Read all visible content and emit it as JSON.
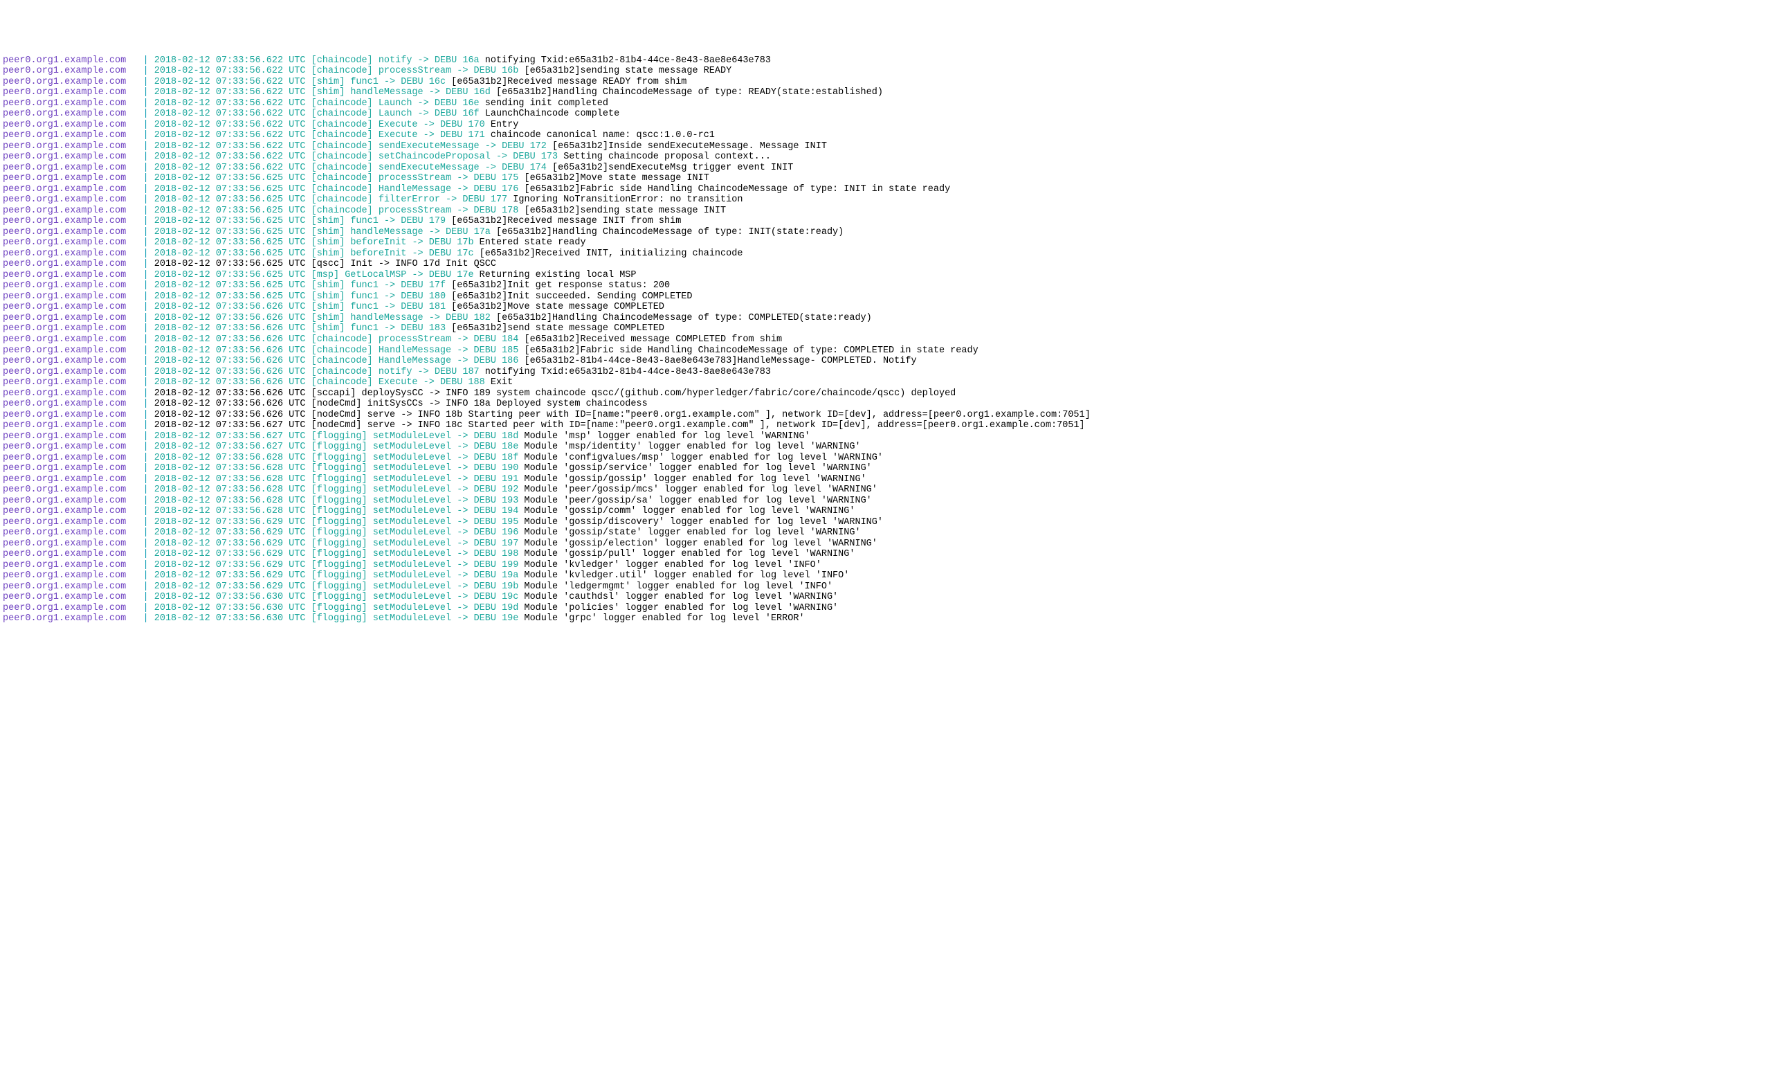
{
  "host": "peer0.org1.example.com",
  "separator": "|",
  "lines": [
    {
      "ts": "2018-02-12 07:33:56.622 UTC",
      "mod": "[chaincode]",
      "fn": "notify",
      "lvl": "DEBU",
      "num": "16a",
      "msg": "notifying Txid:e65a31b2-81b4-44ce-8e43-8ae8e643e783",
      "info": false
    },
    {
      "ts": "2018-02-12 07:33:56.622 UTC",
      "mod": "[chaincode]",
      "fn": "processStream",
      "lvl": "DEBU",
      "num": "16b",
      "msg": "[e65a31b2]sending state message READY",
      "info": false
    },
    {
      "ts": "2018-02-12 07:33:56.622 UTC",
      "mod": "[shim]",
      "fn": "func1",
      "lvl": "DEBU",
      "num": "16c",
      "msg": "[e65a31b2]Received message READY from shim",
      "info": false
    },
    {
      "ts": "2018-02-12 07:33:56.622 UTC",
      "mod": "[shim]",
      "fn": "handleMessage",
      "lvl": "DEBU",
      "num": "16d",
      "msg": "[e65a31b2]Handling ChaincodeMessage of type: READY(state:established)",
      "info": false
    },
    {
      "ts": "2018-02-12 07:33:56.622 UTC",
      "mod": "[chaincode]",
      "fn": "Launch",
      "lvl": "DEBU",
      "num": "16e",
      "msg": "sending init completed",
      "info": false
    },
    {
      "ts": "2018-02-12 07:33:56.622 UTC",
      "mod": "[chaincode]",
      "fn": "Launch",
      "lvl": "DEBU",
      "num": "16f",
      "msg": "LaunchChaincode complete",
      "info": false
    },
    {
      "ts": "2018-02-12 07:33:56.622 UTC",
      "mod": "[chaincode]",
      "fn": "Execute",
      "lvl": "DEBU",
      "num": "170",
      "msg": "Entry",
      "info": false
    },
    {
      "ts": "2018-02-12 07:33:56.622 UTC",
      "mod": "[chaincode]",
      "fn": "Execute",
      "lvl": "DEBU",
      "num": "171",
      "msg": "chaincode canonical name: qscc:1.0.0-rc1",
      "info": false
    },
    {
      "ts": "2018-02-12 07:33:56.622 UTC",
      "mod": "[chaincode]",
      "fn": "sendExecuteMessage",
      "lvl": "DEBU",
      "num": "172",
      "msg": "[e65a31b2]Inside sendExecuteMessage. Message INIT",
      "info": false
    },
    {
      "ts": "2018-02-12 07:33:56.622 UTC",
      "mod": "[chaincode]",
      "fn": "setChaincodeProposal",
      "lvl": "DEBU",
      "num": "173",
      "msg": "Setting chaincode proposal context...",
      "info": false
    },
    {
      "ts": "2018-02-12 07:33:56.622 UTC",
      "mod": "[chaincode]",
      "fn": "sendExecuteMessage",
      "lvl": "DEBU",
      "num": "174",
      "msg": "[e65a31b2]sendExecuteMsg trigger event INIT",
      "info": false
    },
    {
      "ts": "2018-02-12 07:33:56.625 UTC",
      "mod": "[chaincode]",
      "fn": "processStream",
      "lvl": "DEBU",
      "num": "175",
      "msg": "[e65a31b2]Move state message INIT",
      "info": false
    },
    {
      "ts": "2018-02-12 07:33:56.625 UTC",
      "mod": "[chaincode]",
      "fn": "HandleMessage",
      "lvl": "DEBU",
      "num": "176",
      "msg": "[e65a31b2]Fabric side Handling ChaincodeMessage of type: INIT in state ready",
      "info": false
    },
    {
      "ts": "2018-02-12 07:33:56.625 UTC",
      "mod": "[chaincode]",
      "fn": "filterError",
      "lvl": "DEBU",
      "num": "177",
      "msg": "Ignoring NoTransitionError: no transition",
      "info": false
    },
    {
      "ts": "2018-02-12 07:33:56.625 UTC",
      "mod": "[chaincode]",
      "fn": "processStream",
      "lvl": "DEBU",
      "num": "178",
      "msg": "[e65a31b2]sending state message INIT",
      "info": false
    },
    {
      "ts": "2018-02-12 07:33:56.625 UTC",
      "mod": "[shim]",
      "fn": "func1",
      "lvl": "DEBU",
      "num": "179",
      "msg": "[e65a31b2]Received message INIT from shim",
      "info": false
    },
    {
      "ts": "2018-02-12 07:33:56.625 UTC",
      "mod": "[shim]",
      "fn": "handleMessage",
      "lvl": "DEBU",
      "num": "17a",
      "msg": "[e65a31b2]Handling ChaincodeMessage of type: INIT(state:ready)",
      "info": false
    },
    {
      "ts": "2018-02-12 07:33:56.625 UTC",
      "mod": "[shim]",
      "fn": "beforeInit",
      "lvl": "DEBU",
      "num": "17b",
      "msg": "Entered state ready",
      "info": false
    },
    {
      "ts": "2018-02-12 07:33:56.625 UTC",
      "mod": "[shim]",
      "fn": "beforeInit",
      "lvl": "DEBU",
      "num": "17c",
      "msg": "[e65a31b2]Received INIT, initializing chaincode",
      "info": false
    },
    {
      "ts": "2018-02-12 07:33:56.625 UTC",
      "mod": "[qscc]",
      "fn": "Init",
      "lvl": "INFO",
      "num": "17d",
      "msg": "Init QSCC",
      "info": true
    },
    {
      "ts": "2018-02-12 07:33:56.625 UTC",
      "mod": "[msp]",
      "fn": "GetLocalMSP",
      "lvl": "DEBU",
      "num": "17e",
      "msg": "Returning existing local MSP",
      "info": false
    },
    {
      "ts": "2018-02-12 07:33:56.625 UTC",
      "mod": "[shim]",
      "fn": "func1",
      "lvl": "DEBU",
      "num": "17f",
      "msg": "[e65a31b2]Init get response status: 200",
      "info": false
    },
    {
      "ts": "2018-02-12 07:33:56.625 UTC",
      "mod": "[shim]",
      "fn": "func1",
      "lvl": "DEBU",
      "num": "180",
      "msg": "[e65a31b2]Init succeeded. Sending COMPLETED",
      "info": false
    },
    {
      "ts": "2018-02-12 07:33:56.626 UTC",
      "mod": "[shim]",
      "fn": "func1",
      "lvl": "DEBU",
      "num": "181",
      "msg": "[e65a31b2]Move state message COMPLETED",
      "info": false
    },
    {
      "ts": "2018-02-12 07:33:56.626 UTC",
      "mod": "[shim]",
      "fn": "handleMessage",
      "lvl": "DEBU",
      "num": "182",
      "msg": "[e65a31b2]Handling ChaincodeMessage of type: COMPLETED(state:ready)",
      "info": false
    },
    {
      "ts": "2018-02-12 07:33:56.626 UTC",
      "mod": "[shim]",
      "fn": "func1",
      "lvl": "DEBU",
      "num": "183",
      "msg": "[e65a31b2]send state message COMPLETED",
      "info": false
    },
    {
      "ts": "2018-02-12 07:33:56.626 UTC",
      "mod": "[chaincode]",
      "fn": "processStream",
      "lvl": "DEBU",
      "num": "184",
      "msg": "[e65a31b2]Received message COMPLETED from shim",
      "info": false
    },
    {
      "ts": "2018-02-12 07:33:56.626 UTC",
      "mod": "[chaincode]",
      "fn": "HandleMessage",
      "lvl": "DEBU",
      "num": "185",
      "msg": "[e65a31b2]Fabric side Handling ChaincodeMessage of type: COMPLETED in state ready",
      "info": false
    },
    {
      "ts": "2018-02-12 07:33:56.626 UTC",
      "mod": "[chaincode]",
      "fn": "HandleMessage",
      "lvl": "DEBU",
      "num": "186",
      "msg": "[e65a31b2-81b4-44ce-8e43-8ae8e643e783]HandleMessage- COMPLETED. Notify",
      "info": false
    },
    {
      "ts": "2018-02-12 07:33:56.626 UTC",
      "mod": "[chaincode]",
      "fn": "notify",
      "lvl": "DEBU",
      "num": "187",
      "msg": "notifying Txid:e65a31b2-81b4-44ce-8e43-8ae8e643e783",
      "info": false
    },
    {
      "ts": "2018-02-12 07:33:56.626 UTC",
      "mod": "[chaincode]",
      "fn": "Execute",
      "lvl": "DEBU",
      "num": "188",
      "msg": "Exit",
      "info": false
    },
    {
      "ts": "2018-02-12 07:33:56.626 UTC",
      "mod": "[sccapi]",
      "fn": "deploySysCC",
      "lvl": "INFO",
      "num": "189",
      "msg": "system chaincode qscc/(github.com/hyperledger/fabric/core/chaincode/qscc) deployed",
      "info": true
    },
    {
      "ts": "2018-02-12 07:33:56.626 UTC",
      "mod": "[nodeCmd]",
      "fn": "initSysCCs",
      "lvl": "INFO",
      "num": "18a",
      "msg": "Deployed system chaincodess",
      "info": true
    },
    {
      "ts": "2018-02-12 07:33:56.626 UTC",
      "mod": "[nodeCmd]",
      "fn": "serve",
      "lvl": "INFO",
      "num": "18b",
      "msg": "Starting peer with ID=[name:\"peer0.org1.example.com\" ], network ID=[dev], address=[peer0.org1.example.com:7051]",
      "info": true
    },
    {
      "ts": "2018-02-12 07:33:56.627 UTC",
      "mod": "[nodeCmd]",
      "fn": "serve",
      "lvl": "INFO",
      "num": "18c",
      "msg": "Started peer with ID=[name:\"peer0.org1.example.com\" ], network ID=[dev], address=[peer0.org1.example.com:7051]",
      "info": true
    },
    {
      "ts": "2018-02-12 07:33:56.627 UTC",
      "mod": "[flogging]",
      "fn": "setModuleLevel",
      "lvl": "DEBU",
      "num": "18d",
      "msg": "Module 'msp' logger enabled for log level 'WARNING'",
      "info": false
    },
    {
      "ts": "2018-02-12 07:33:56.627 UTC",
      "mod": "[flogging]",
      "fn": "setModuleLevel",
      "lvl": "DEBU",
      "num": "18e",
      "msg": "Module 'msp/identity' logger enabled for log level 'WARNING'",
      "info": false
    },
    {
      "ts": "2018-02-12 07:33:56.628 UTC",
      "mod": "[flogging]",
      "fn": "setModuleLevel",
      "lvl": "DEBU",
      "num": "18f",
      "msg": "Module 'configvalues/msp' logger enabled for log level 'WARNING'",
      "info": false
    },
    {
      "ts": "2018-02-12 07:33:56.628 UTC",
      "mod": "[flogging]",
      "fn": "setModuleLevel",
      "lvl": "DEBU",
      "num": "190",
      "msg": "Module 'gossip/service' logger enabled for log level 'WARNING'",
      "info": false
    },
    {
      "ts": "2018-02-12 07:33:56.628 UTC",
      "mod": "[flogging]",
      "fn": "setModuleLevel",
      "lvl": "DEBU",
      "num": "191",
      "msg": "Module 'gossip/gossip' logger enabled for log level 'WARNING'",
      "info": false
    },
    {
      "ts": "2018-02-12 07:33:56.628 UTC",
      "mod": "[flogging]",
      "fn": "setModuleLevel",
      "lvl": "DEBU",
      "num": "192",
      "msg": "Module 'peer/gossip/mcs' logger enabled for log level 'WARNING'",
      "info": false
    },
    {
      "ts": "2018-02-12 07:33:56.628 UTC",
      "mod": "[flogging]",
      "fn": "setModuleLevel",
      "lvl": "DEBU",
      "num": "193",
      "msg": "Module 'peer/gossip/sa' logger enabled for log level 'WARNING'",
      "info": false
    },
    {
      "ts": "2018-02-12 07:33:56.628 UTC",
      "mod": "[flogging]",
      "fn": "setModuleLevel",
      "lvl": "DEBU",
      "num": "194",
      "msg": "Module 'gossip/comm' logger enabled for log level 'WARNING'",
      "info": false
    },
    {
      "ts": "2018-02-12 07:33:56.629 UTC",
      "mod": "[flogging]",
      "fn": "setModuleLevel",
      "lvl": "DEBU",
      "num": "195",
      "msg": "Module 'gossip/discovery' logger enabled for log level 'WARNING'",
      "info": false
    },
    {
      "ts": "2018-02-12 07:33:56.629 UTC",
      "mod": "[flogging]",
      "fn": "setModuleLevel",
      "lvl": "DEBU",
      "num": "196",
      "msg": "Module 'gossip/state' logger enabled for log level 'WARNING'",
      "info": false
    },
    {
      "ts": "2018-02-12 07:33:56.629 UTC",
      "mod": "[flogging]",
      "fn": "setModuleLevel",
      "lvl": "DEBU",
      "num": "197",
      "msg": "Module 'gossip/election' logger enabled for log level 'WARNING'",
      "info": false
    },
    {
      "ts": "2018-02-12 07:33:56.629 UTC",
      "mod": "[flogging]",
      "fn": "setModuleLevel",
      "lvl": "DEBU",
      "num": "198",
      "msg": "Module 'gossip/pull' logger enabled for log level 'WARNING'",
      "info": false
    },
    {
      "ts": "2018-02-12 07:33:56.629 UTC",
      "mod": "[flogging]",
      "fn": "setModuleLevel",
      "lvl": "DEBU",
      "num": "199",
      "msg": "Module 'kvledger' logger enabled for log level 'INFO'",
      "info": false
    },
    {
      "ts": "2018-02-12 07:33:56.629 UTC",
      "mod": "[flogging]",
      "fn": "setModuleLevel",
      "lvl": "DEBU",
      "num": "19a",
      "msg": "Module 'kvledger.util' logger enabled for log level 'INFO'",
      "info": false
    },
    {
      "ts": "2018-02-12 07:33:56.629 UTC",
      "mod": "[flogging]",
      "fn": "setModuleLevel",
      "lvl": "DEBU",
      "num": "19b",
      "msg": "Module 'ledgermgmt' logger enabled for log level 'INFO'",
      "info": false
    },
    {
      "ts": "2018-02-12 07:33:56.630 UTC",
      "mod": "[flogging]",
      "fn": "setModuleLevel",
      "lvl": "DEBU",
      "num": "19c",
      "msg": "Module 'cauthdsl' logger enabled for log level 'WARNING'",
      "info": false
    },
    {
      "ts": "2018-02-12 07:33:56.630 UTC",
      "mod": "[flogging]",
      "fn": "setModuleLevel",
      "lvl": "DEBU",
      "num": "19d",
      "msg": "Module 'policies' logger enabled for log level 'WARNING'",
      "info": false
    },
    {
      "ts": "2018-02-12 07:33:56.630 UTC",
      "mod": "[flogging]",
      "fn": "setModuleLevel",
      "lvl": "DEBU",
      "num": "19e",
      "msg": "Module 'grpc' logger enabled for log level 'ERROR'",
      "info": false
    }
  ]
}
